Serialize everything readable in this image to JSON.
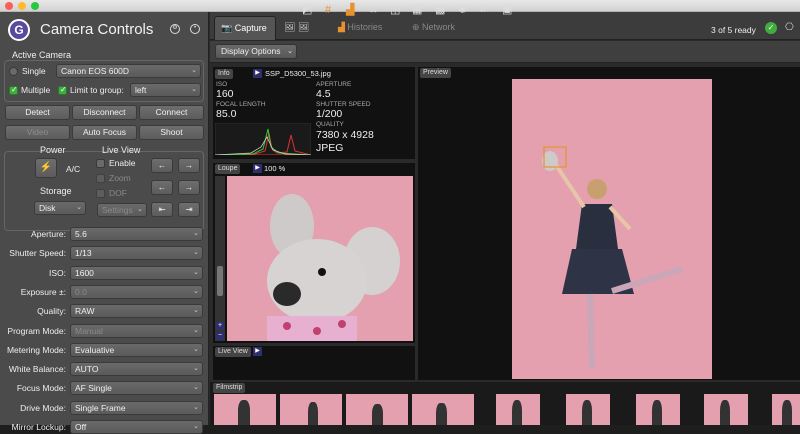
{
  "app": {
    "title": "Camera Controls"
  },
  "left": {
    "active_camera": {
      "label": "Active Camera",
      "single_label": "Single",
      "camera_value": "Canon EOS 600D",
      "multiple_label": "Multiple",
      "limit_label": "Limit to group:",
      "group_value": "left"
    },
    "buttons": {
      "detect": "Detect",
      "disconnect": "Disconnect",
      "connect": "Connect",
      "video": "Video",
      "autofocus": "Auto Focus",
      "shoot": "Shoot"
    },
    "power": {
      "label": "Power",
      "value": "A/C"
    },
    "storage": {
      "label": "Storage",
      "value": "Disk"
    },
    "liveview": {
      "label": "Live View",
      "enable": "Enable",
      "zoom": "Zoom",
      "dof": "DOF",
      "settings": "Settings"
    },
    "settings": [
      {
        "label": "Aperture:",
        "value": "5.6"
      },
      {
        "label": "Shutter Speed:",
        "value": "1/13"
      },
      {
        "label": "ISO:",
        "value": "1600"
      },
      {
        "label": "Exposure ±:",
        "value": "0.0"
      },
      {
        "label": "Quality:",
        "value": "RAW"
      },
      {
        "label": "Program Mode:",
        "value": "Manual"
      },
      {
        "label": "Metering Mode:",
        "value": "Evaluative"
      },
      {
        "label": "White Balance:",
        "value": "AUTO"
      },
      {
        "label": "Focus Mode:",
        "value": "AF Single"
      },
      {
        "label": "Drive Mode:",
        "value": "Single Frame"
      },
      {
        "label": "Mirror Lockup:",
        "value": "Off"
      }
    ]
  },
  "tabs": [
    {
      "label": "Capture"
    },
    {
      "label": ""
    },
    {
      "label": "Histories"
    },
    {
      "label": "Network"
    }
  ],
  "status": {
    "ready": "3 of 5 ready"
  },
  "toolbar": {
    "display_options": "Display Options"
  },
  "info": {
    "header": "Info",
    "filename": "SSP_D5300_53.jpg",
    "iso_key": "ISO",
    "iso": "160",
    "aperture_key": "APERTURE",
    "aperture": "4.5",
    "focal_key": "FOCAL LENGTH",
    "focal": "85.0",
    "shutter_key": "SHUTTER SPEED",
    "shutter": "1/200",
    "quality_key": "QUALITY",
    "dimensions": "7380 x 4928",
    "format": "JPEG"
  },
  "loupe": {
    "header": "Loupe",
    "zoom": "100 %"
  },
  "liveview_panel": {
    "header": "Live View"
  },
  "preview": {
    "header": "Preview"
  },
  "filmstrip": {
    "header": "Filmstrip"
  },
  "colors": {
    "accent_orange": "#e8922f",
    "ok_green": "#3fae3f",
    "backdrop_pink": "#e4a0ae"
  }
}
